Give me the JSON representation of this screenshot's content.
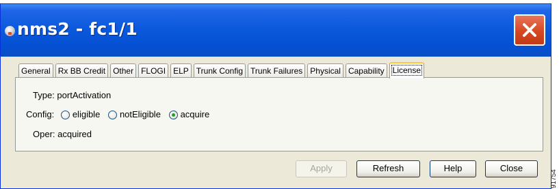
{
  "window": {
    "title": "nms2 - fc1/1",
    "app_icon": "app-icon",
    "close_icon": "close-icon"
  },
  "tabs": [
    {
      "label": "General",
      "active": false
    },
    {
      "label": "Rx BB Credit",
      "active": false
    },
    {
      "label": "Other",
      "active": false
    },
    {
      "label": "FLOGI",
      "active": false
    },
    {
      "label": "ELP",
      "active": false
    },
    {
      "label": "Trunk Config",
      "active": false
    },
    {
      "label": "Trunk Failures",
      "active": false
    },
    {
      "label": "Physical",
      "active": false
    },
    {
      "label": "Capability",
      "active": false
    },
    {
      "label": "License",
      "active": true
    }
  ],
  "license": {
    "type_label": "Type:",
    "type_value": "portActivation",
    "config_label": "Config:",
    "config_options": [
      {
        "label": "eligible",
        "selected": false
      },
      {
        "label": "notEligible",
        "selected": false
      },
      {
        "label": "acquire",
        "selected": true
      }
    ],
    "oper_label": "Oper:",
    "oper_value": "acquired"
  },
  "buttons": {
    "apply": "Apply",
    "refresh": "Refresh",
    "help": "Help",
    "close": "Close"
  },
  "side_label": "91754",
  "colors": {
    "titlebar": "#0a58dc",
    "close_button": "#d64822",
    "dialog_bg": "#ece9d8",
    "active_tab_accent": "#ffc83c",
    "radio_checked": "#21a121"
  }
}
